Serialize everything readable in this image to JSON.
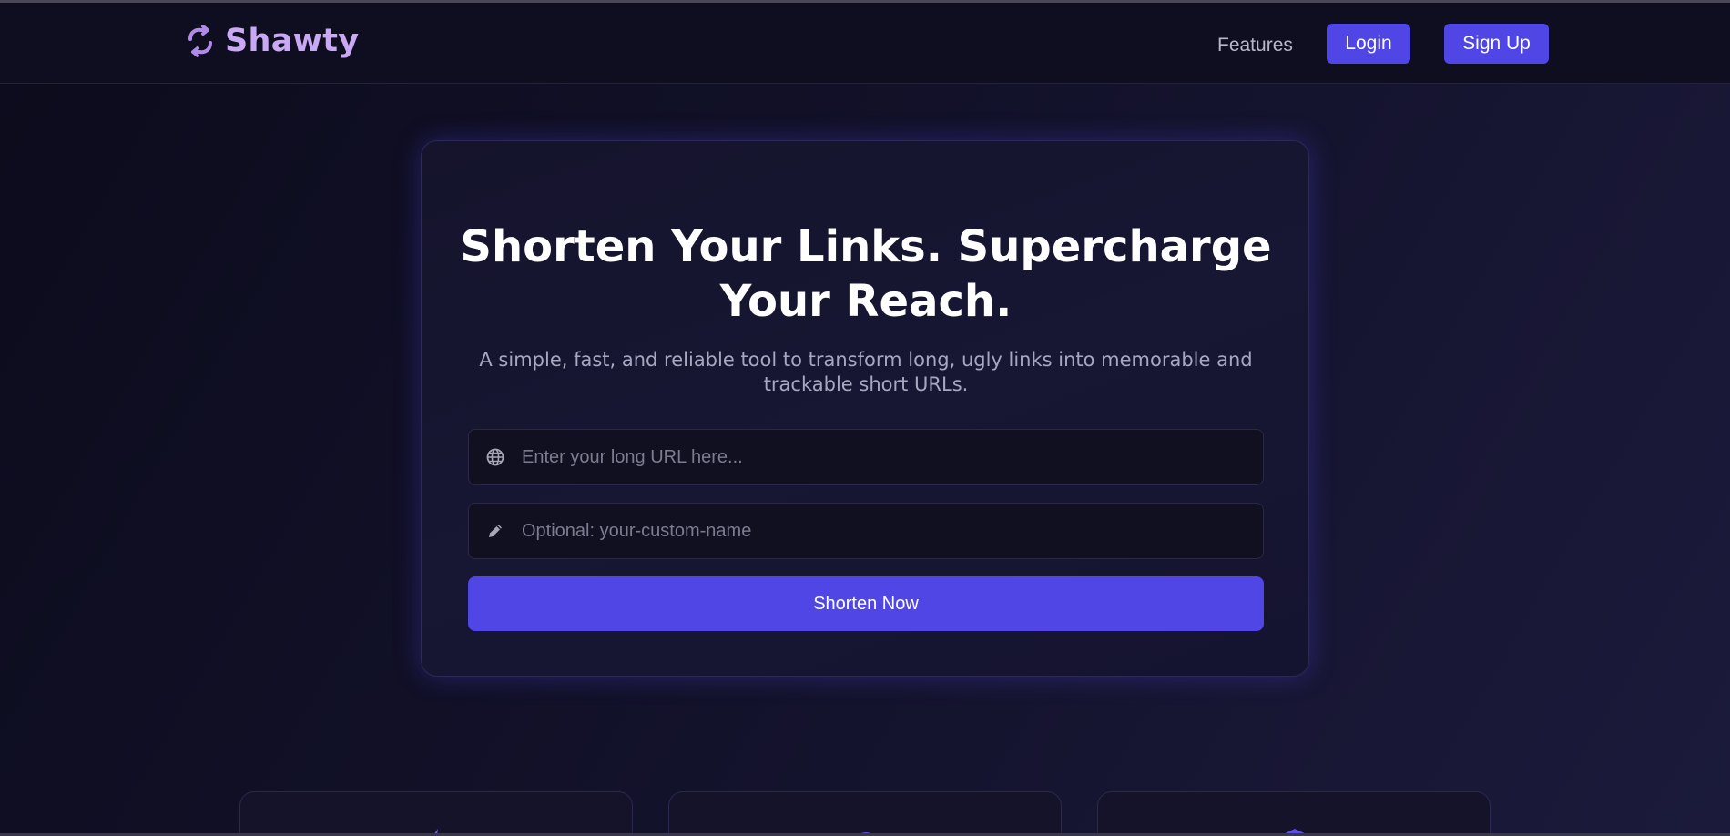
{
  "header": {
    "brand": {
      "name": "Shawty",
      "icon": "link-icon"
    },
    "nav": {
      "features_label": "Features"
    },
    "login_label": "Login",
    "signup_label": "Sign Up"
  },
  "hero": {
    "title_line1": "Shorten Your Links. Supercharge",
    "title_line2": "Your Reach.",
    "subtitle_line1": "A simple, fast, and reliable tool to transform long, ugly links into memorable and",
    "subtitle_line2": "trackable short URLs.",
    "url_input": {
      "placeholder": "Enter your long URL here...",
      "value": "",
      "icon": "globe-icon"
    },
    "custom_name_input": {
      "placeholder": "Optional: your-custom-name",
      "value": "",
      "icon": "pencil-icon"
    },
    "submit_label": "Shorten Now"
  },
  "features": [
    {
      "icon": "bolt-icon"
    },
    {
      "icon": "chart-icon"
    },
    {
      "icon": "shield-icon"
    }
  ],
  "colors": {
    "accent": "#4f46e5",
    "brand_text": "#c9a8f4",
    "background": "#0e0d1f",
    "card": "#161530"
  }
}
